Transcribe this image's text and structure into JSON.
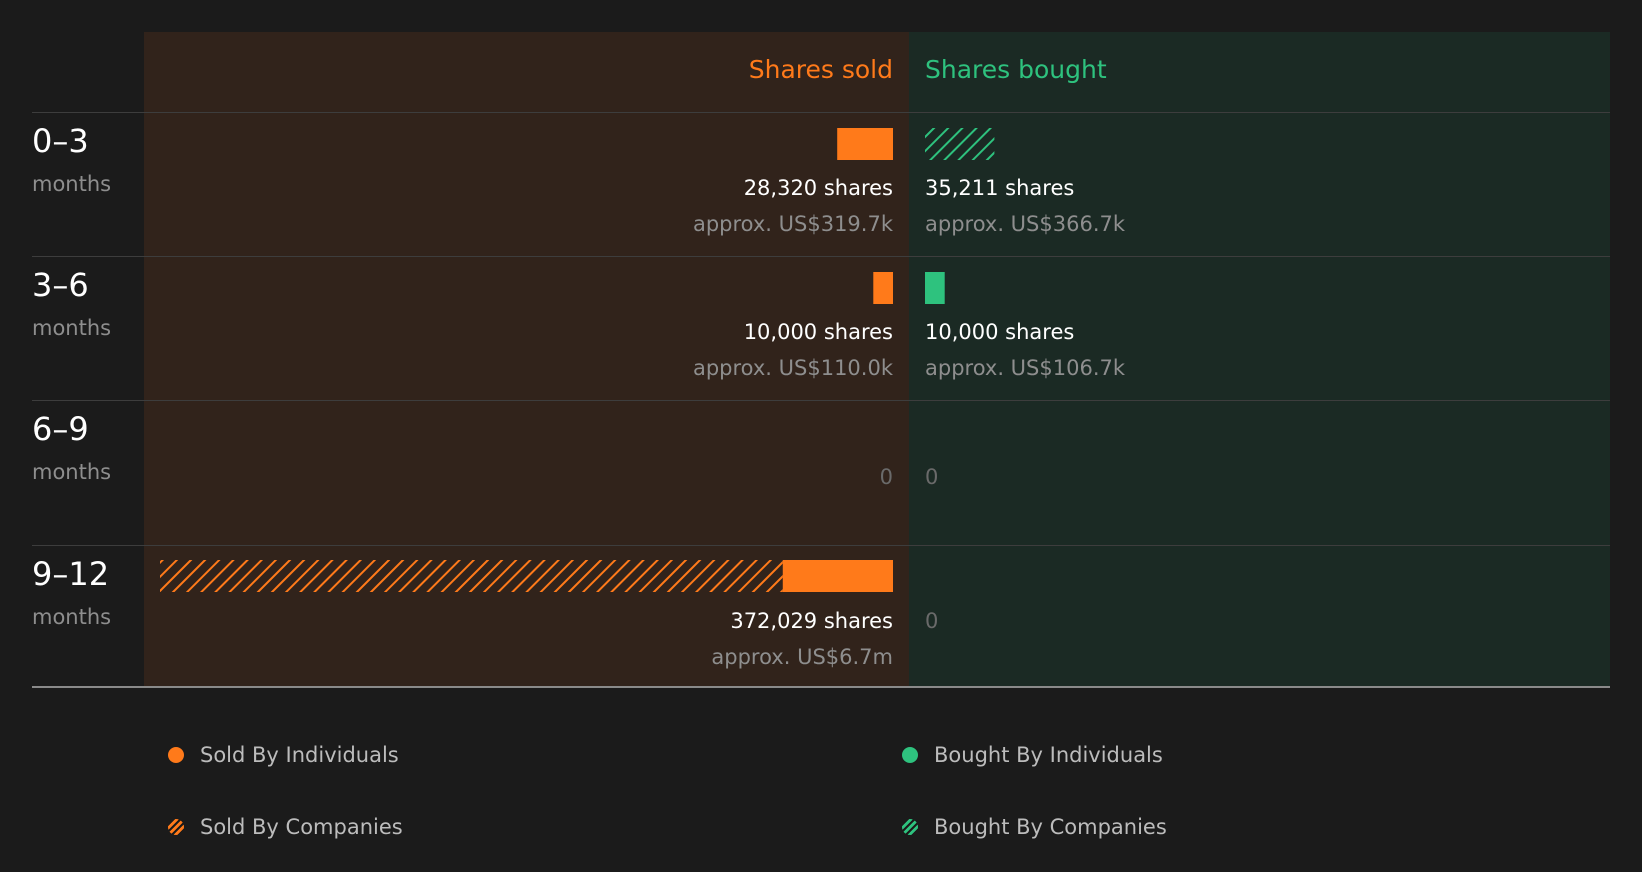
{
  "chart_data": {
    "type": "bar",
    "orientation": "horizontal-diverging",
    "headers": {
      "sold": "Shares sold",
      "bought": "Shares bought"
    },
    "unit": "shares",
    "categories": [
      {
        "label": "0–3",
        "sub": "months"
      },
      {
        "label": "3–6",
        "sub": "months"
      },
      {
        "label": "6–9",
        "sub": "months"
      },
      {
        "label": "9–12",
        "sub": "months"
      }
    ],
    "series": [
      {
        "name": "Sold By Individuals",
        "side": "sold",
        "pattern": "solid",
        "values": [
          28320,
          10000,
          0,
          56000
        ]
      },
      {
        "name": "Sold By Companies",
        "side": "sold",
        "pattern": "hatched",
        "values": [
          0,
          0,
          0,
          316029
        ]
      },
      {
        "name": "Bought By Individuals",
        "side": "bought",
        "pattern": "solid",
        "values": [
          0,
          10000,
          0,
          0
        ]
      },
      {
        "name": "Bought By Companies",
        "side": "bought",
        "pattern": "hatched",
        "values": [
          35211,
          0,
          0,
          0
        ]
      }
    ],
    "totals": {
      "sold": [
        {
          "shares": "28,320 shares",
          "value": "approx. US$319.7k"
        },
        {
          "shares": "10,000 shares",
          "value": "approx. US$110.0k"
        },
        {
          "shares": "0",
          "value": ""
        },
        {
          "shares": "372,029 shares",
          "value": "approx. US$6.7m"
        }
      ],
      "bought": [
        {
          "shares": "35,211 shares",
          "value": "approx. US$366.7k"
        },
        {
          "shares": "10,000 shares",
          "value": "approx. US$106.7k"
        },
        {
          "shares": "0",
          "value": ""
        },
        {
          "shares": "0",
          "value": ""
        }
      ]
    },
    "xlim": [
      0,
      372029
    ],
    "legend": [
      {
        "label": "Sold By Individuals",
        "side": "sold",
        "pattern": "solid"
      },
      {
        "label": "Sold By Companies",
        "side": "sold",
        "pattern": "hatched"
      },
      {
        "label": "Bought By Individuals",
        "side": "bought",
        "pattern": "solid"
      },
      {
        "label": "Bought By Companies",
        "side": "bought",
        "pattern": "hatched"
      }
    ],
    "legend_position": "bottom"
  },
  "colors": {
    "sold": "#ff7a1a",
    "bought": "#2ec27e",
    "sold_bg": "#31231b",
    "bought_bg": "#1b2a24"
  }
}
